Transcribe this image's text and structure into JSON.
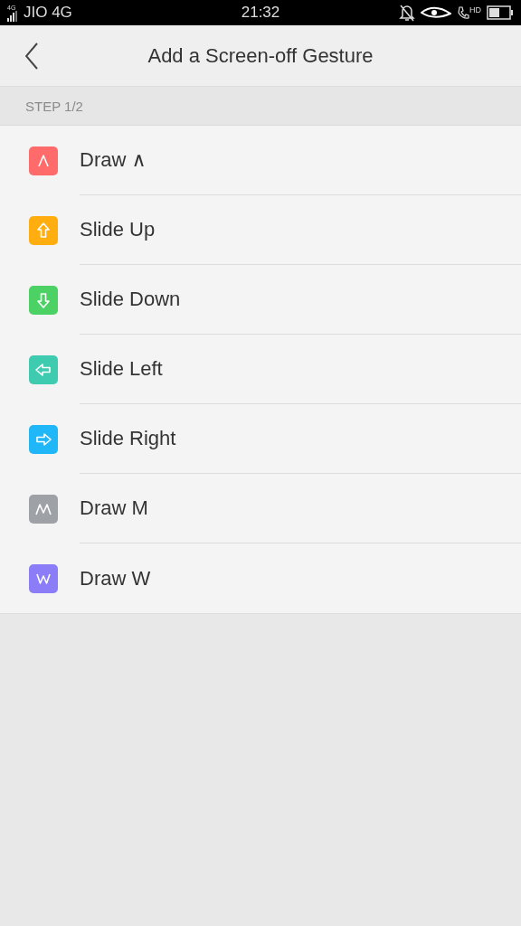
{
  "status_bar": {
    "network_badge": "4G",
    "carrier": "JIO 4G",
    "time": "21:32",
    "call_badge": "HD"
  },
  "header": {
    "title": "Add a Screen-off Gesture"
  },
  "section": {
    "label": "STEP 1/2"
  },
  "gestures": [
    {
      "label": "Draw ∧",
      "kind": "caret",
      "color": "#ff6b6b"
    },
    {
      "label": "Slide Up",
      "kind": "up",
      "color": "#ffad0f"
    },
    {
      "label": "Slide Down",
      "kind": "down",
      "color": "#4cd264"
    },
    {
      "label": "Slide Left",
      "kind": "left",
      "color": "#3fcbb0"
    },
    {
      "label": "Slide Right",
      "kind": "right",
      "color": "#1fb7f7"
    },
    {
      "label": "Draw M",
      "kind": "m",
      "color": "#9ea1a6"
    },
    {
      "label": "Draw W",
      "kind": "w",
      "color": "#8b7df8"
    }
  ]
}
